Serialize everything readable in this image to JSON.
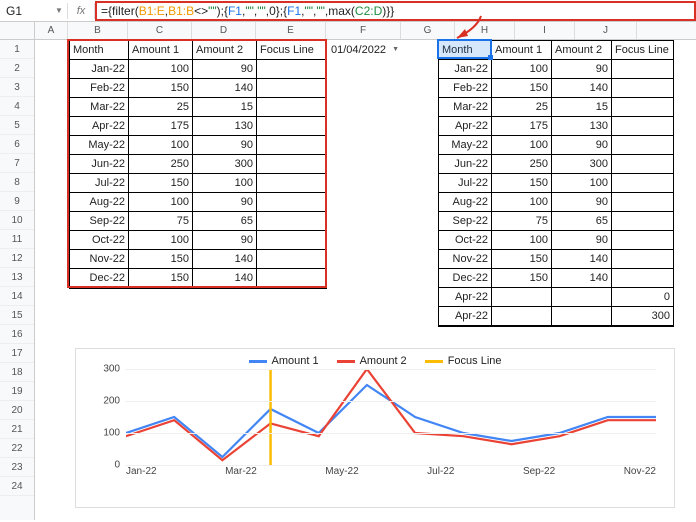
{
  "cell_ref": "G1",
  "fx_label": "fx",
  "formula": {
    "raw": "={filter(B1:E,B1:B<>\"\");{F1,\"\",\"\",0};{F1,\"\",\"\",max(C2:D)}}",
    "parts": [
      {
        "t": "=",
        "c": "f-eq"
      },
      {
        "t": "{",
        "c": ""
      },
      {
        "t": "filter",
        "c": "f-kw"
      },
      {
        "t": "(",
        "c": ""
      },
      {
        "t": "B1:E",
        "c": "f-r1"
      },
      {
        "t": ",",
        "c": ""
      },
      {
        "t": "B1:B",
        "c": "f-r1"
      },
      {
        "t": "<>",
        "c": ""
      },
      {
        "t": "\"\"",
        "c": "f-str"
      },
      {
        "t": ");{",
        "c": ""
      },
      {
        "t": "F1",
        "c": "f-r2"
      },
      {
        "t": ",",
        "c": ""
      },
      {
        "t": "\"\"",
        "c": "f-str"
      },
      {
        "t": ",",
        "c": ""
      },
      {
        "t": "\"\"",
        "c": "f-str"
      },
      {
        "t": ",",
        "c": ""
      },
      {
        "t": "0",
        "c": ""
      },
      {
        "t": "};{",
        "c": ""
      },
      {
        "t": "F1",
        "c": "f-r2"
      },
      {
        "t": ",",
        "c": ""
      },
      {
        "t": "\"\"",
        "c": "f-str"
      },
      {
        "t": ",",
        "c": ""
      },
      {
        "t": "\"\"",
        "c": "f-str"
      },
      {
        "t": ",",
        "c": ""
      },
      {
        "t": "max",
        "c": "f-kw"
      },
      {
        "t": "(",
        "c": ""
      },
      {
        "t": "C2:D",
        "c": "f-r3"
      },
      {
        "t": ")}}",
        "c": ""
      }
    ]
  },
  "columns": [
    "A",
    "B",
    "C",
    "D",
    "E",
    "F",
    "G",
    "H",
    "I",
    "J"
  ],
  "row_count": 24,
  "date_f1": "01/04/2022",
  "table1": {
    "headers": [
      "Month",
      "Amount 1",
      "Amount 2",
      "Focus Line"
    ],
    "rows": [
      [
        "Jan-22",
        "100",
        "90",
        ""
      ],
      [
        "Feb-22",
        "150",
        "140",
        ""
      ],
      [
        "Mar-22",
        "25",
        "15",
        ""
      ],
      [
        "Apr-22",
        "175",
        "130",
        ""
      ],
      [
        "May-22",
        "100",
        "90",
        ""
      ],
      [
        "Jun-22",
        "250",
        "300",
        ""
      ],
      [
        "Jul-22",
        "150",
        "100",
        ""
      ],
      [
        "Aug-22",
        "100",
        "90",
        ""
      ],
      [
        "Sep-22",
        "75",
        "65",
        ""
      ],
      [
        "Oct-22",
        "100",
        "90",
        ""
      ],
      [
        "Nov-22",
        "150",
        "140",
        ""
      ],
      [
        "Dec-22",
        "150",
        "140",
        ""
      ]
    ]
  },
  "table2": {
    "headers": [
      "Month",
      "Amount 1",
      "Amount 2",
      "Focus Line"
    ],
    "rows": [
      [
        "Jan-22",
        "100",
        "90",
        ""
      ],
      [
        "Feb-22",
        "150",
        "140",
        ""
      ],
      [
        "Mar-22",
        "25",
        "15",
        ""
      ],
      [
        "Apr-22",
        "175",
        "130",
        ""
      ],
      [
        "May-22",
        "100",
        "90",
        ""
      ],
      [
        "Jun-22",
        "250",
        "300",
        ""
      ],
      [
        "Jul-22",
        "150",
        "100",
        ""
      ],
      [
        "Aug-22",
        "100",
        "90",
        ""
      ],
      [
        "Sep-22",
        "75",
        "65",
        ""
      ],
      [
        "Oct-22",
        "100",
        "90",
        ""
      ],
      [
        "Nov-22",
        "150",
        "140",
        ""
      ],
      [
        "Dec-22",
        "150",
        "140",
        ""
      ],
      [
        "Apr-22",
        "",
        "",
        "0"
      ],
      [
        "Apr-22",
        "",
        "",
        "300"
      ]
    ]
  },
  "chart_data": {
    "type": "line",
    "title": "",
    "xlabel": "",
    "ylabel": "",
    "ylim": [
      0,
      300
    ],
    "y_ticks": [
      0,
      100,
      200,
      300
    ],
    "categories": [
      "Jan-22",
      "Feb-22",
      "Mar-22",
      "Apr-22",
      "May-22",
      "Jun-22",
      "Jul-22",
      "Aug-22",
      "Sep-22",
      "Oct-22",
      "Nov-22",
      "Dec-22"
    ],
    "x_tick_labels": [
      "Jan-22",
      "Mar-22",
      "May-22",
      "Jul-22",
      "Sep-22",
      "Nov-22"
    ],
    "series": [
      {
        "name": "Amount 1",
        "color": "#4285f4",
        "values": [
          100,
          150,
          25,
          175,
          100,
          250,
          150,
          100,
          75,
          100,
          150,
          150
        ]
      },
      {
        "name": "Amount 2",
        "color": "#ea4335",
        "values": [
          90,
          140,
          15,
          130,
          90,
          300,
          100,
          90,
          65,
          90,
          140,
          140
        ]
      },
      {
        "name": "Focus Line",
        "color": "#fbbc04",
        "x": "Apr-22",
        "values": [
          0,
          300
        ]
      }
    ],
    "legend": [
      "Amount 1",
      "Amount 2",
      "Focus Line"
    ]
  }
}
